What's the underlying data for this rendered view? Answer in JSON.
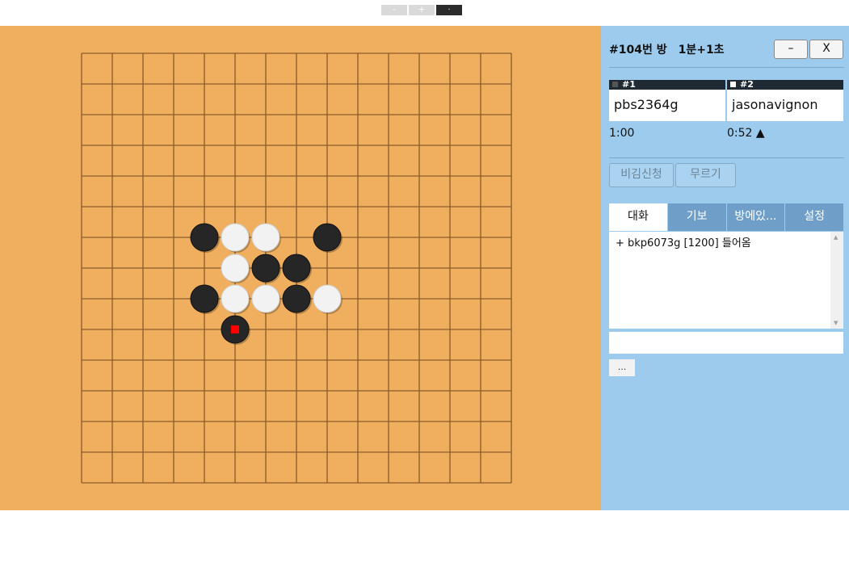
{
  "zoom": {
    "minus": "-",
    "plus": "+",
    "dot": "·"
  },
  "room": {
    "number": "#104번 방",
    "time_rule": "1분+1초",
    "minimize": "–",
    "close": "X"
  },
  "players": [
    {
      "slot": "#1",
      "stone": "black",
      "name": "pbs2364g",
      "clock": "1:00"
    },
    {
      "slot": "#2",
      "stone": "white",
      "name": "jasonavignon",
      "clock": "0:52 ▲"
    }
  ],
  "actions": {
    "draw": "비김신청",
    "undo": "무르기"
  },
  "tabs": [
    "대화",
    "기보",
    "방에있...",
    "설정"
  ],
  "chat": {
    "lines": [
      "+ bkp6073g [1200] 들어옴"
    ],
    "more": "..."
  },
  "board": {
    "size": 15,
    "colors": {
      "wood": "#f0af5e",
      "line": "#8b5a2b",
      "black": "#262626",
      "white": "#f2f2f2",
      "last_move": "#ff0000"
    },
    "stones": [
      {
        "col": 4,
        "row": 6,
        "color": "black"
      },
      {
        "col": 5,
        "row": 6,
        "color": "white"
      },
      {
        "col": 6,
        "row": 6,
        "color": "white"
      },
      {
        "col": 8,
        "row": 6,
        "color": "black"
      },
      {
        "col": 5,
        "row": 7,
        "color": "white"
      },
      {
        "col": 6,
        "row": 7,
        "color": "black"
      },
      {
        "col": 7,
        "row": 7,
        "color": "black"
      },
      {
        "col": 4,
        "row": 8,
        "color": "black"
      },
      {
        "col": 5,
        "row": 8,
        "color": "white"
      },
      {
        "col": 6,
        "row": 8,
        "color": "white"
      },
      {
        "col": 7,
        "row": 8,
        "color": "black"
      },
      {
        "col": 8,
        "row": 8,
        "color": "white"
      },
      {
        "col": 5,
        "row": 9,
        "color": "black",
        "last": true
      }
    ]
  }
}
